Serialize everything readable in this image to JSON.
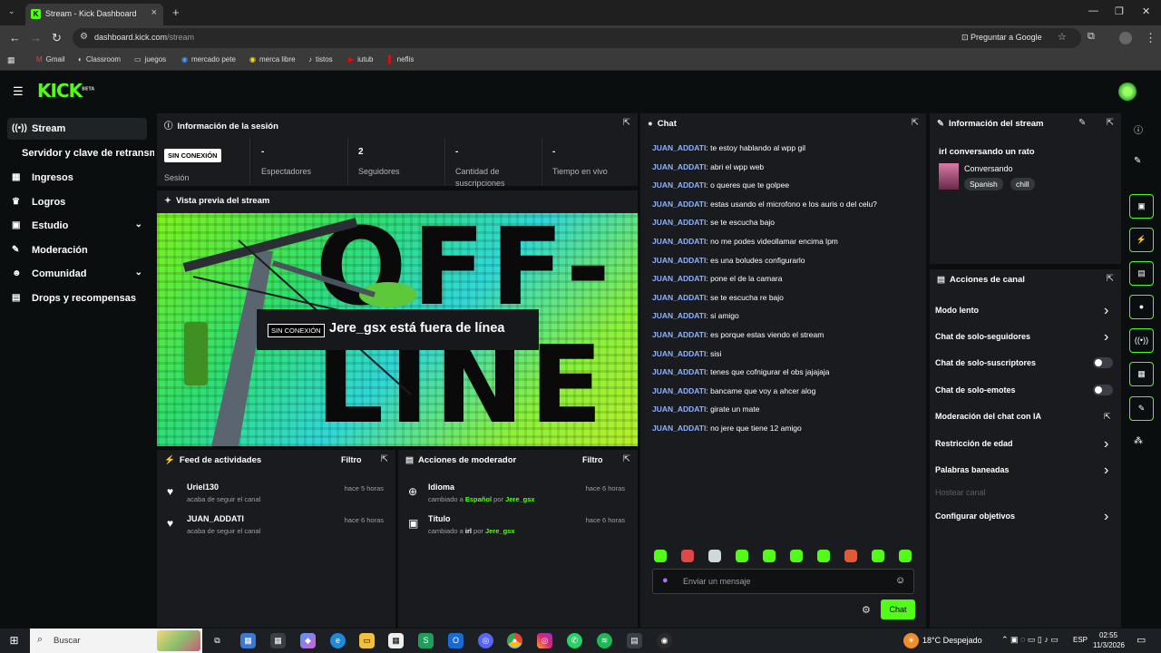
{
  "browser": {
    "tab_title": "Stream - Kick Dashboard",
    "url_host": "dashboard.kick.com",
    "url_path": "/stream",
    "ask_google": "Preguntar a Google",
    "bookmarks": [
      "Gmail",
      "Classroom",
      "juegos",
      "mercado pete",
      "merca libre",
      "tistos",
      "iutub",
      "neflis"
    ]
  },
  "app": {
    "logo": "KICK",
    "logo_tag": "BETA"
  },
  "sidebar": {
    "items": [
      {
        "label": "Stream",
        "icon": "broadcast-icon"
      },
      {
        "label": "Servidor y clave de retransm"
      },
      {
        "label": "Ingresos",
        "icon": "chart-icon"
      },
      {
        "label": "Logros",
        "icon": "trophy-icon"
      },
      {
        "label": "Estudio",
        "icon": "studio-icon"
      },
      {
        "label": "Moderación",
        "icon": "wrench-icon"
      },
      {
        "label": "Comunidad",
        "icon": "users-icon"
      },
      {
        "label": "Drops y recompensas",
        "icon": "gift-icon"
      }
    ]
  },
  "session": {
    "title": "Información de la sesión",
    "status_badge": "SIN CONEXIÓN",
    "status_label": "Sesión",
    "stats": [
      {
        "value": "-",
        "label": "Espectadores"
      },
      {
        "value": "2",
        "label": "Seguidores"
      },
      {
        "value": "-",
        "label": "Cantidad de suscripciones"
      },
      {
        "value": "-",
        "label": "Tiempo en vivo"
      }
    ]
  },
  "preview": {
    "title": "Vista previa del stream",
    "badge": "SIN CONEXIÓN",
    "message": "Jere_gsx está fuera de línea",
    "bg_text_1": "OFF-",
    "bg_text_2": "LINE"
  },
  "feed": {
    "title": "Feed de actividades",
    "filter": "Filtro",
    "items": [
      {
        "name": "Uriel130",
        "desc": "acaba de seguir el canal",
        "time": "hace 5 horas"
      },
      {
        "name": "JUAN_ADDATI",
        "desc": "acaba de seguir el canal",
        "time": "hace 6 horas"
      }
    ]
  },
  "modactions": {
    "title": "Acciones de moderador",
    "filter": "Filtro",
    "items": [
      {
        "name": "Idioma",
        "pre": "cambiado a ",
        "value": "Español",
        "by": " por ",
        "user": "Jere_gsx",
        "time": "hace 6 horas"
      },
      {
        "name": "Título",
        "pre": "cambiado a ",
        "value": "irl",
        "by": " por ",
        "user": "Jere_gsx",
        "time": "hace 6 horas"
      }
    ]
  },
  "chat": {
    "title": "Chat",
    "user": "JUAN_ADDATI",
    "messages": [
      "te estoy hablando al wpp gil",
      "abri el wpp web",
      "o queres que te golpee",
      "estas usando el microfono e los auris o del celu?",
      "se te escucha bajo",
      "no me podes videollamar encima lpm",
      "es una boludes configurarlo",
      "pone el de la camara",
      "se te escucha re bajo",
      "si amigo",
      "es porque estas viendo el stream",
      "sisi",
      "tenes que cofnigurar el obs jajajaja",
      "bancame que voy a ahcer alog",
      "girate un mate",
      "no jere que tiene 12 amigo"
    ],
    "placeholder": "Enviar un mensaje",
    "send": "Chat"
  },
  "streaminfo": {
    "title": "Información del stream",
    "stream_title": "irl conversando un rato",
    "category": "Conversando",
    "tags": [
      "Spanish",
      "chill"
    ]
  },
  "channel_actions": {
    "title": "Acciones de canal",
    "items": [
      {
        "label": "Modo lento",
        "kind": "chevron"
      },
      {
        "label": "Chat de solo-seguidores",
        "kind": "chevron"
      },
      {
        "label": "Chat de solo-suscriptores",
        "kind": "toggle"
      },
      {
        "label": "Chat de solo-emotes",
        "kind": "toggle"
      },
      {
        "label": "Moderación del chat con IA",
        "kind": "external"
      },
      {
        "label": "Restricción de edad",
        "kind": "chevron"
      },
      {
        "label": "Palabras baneadas",
        "kind": "chevron"
      },
      {
        "label": "Hostear canal",
        "kind": "disabled"
      },
      {
        "label": "Configurar objetivos",
        "kind": "chevron"
      }
    ]
  },
  "taskbar": {
    "search": "Buscar",
    "weather": "18°C  Despejado",
    "lang": "ESP",
    "time": "02:55",
    "date": "11/3/2026"
  }
}
